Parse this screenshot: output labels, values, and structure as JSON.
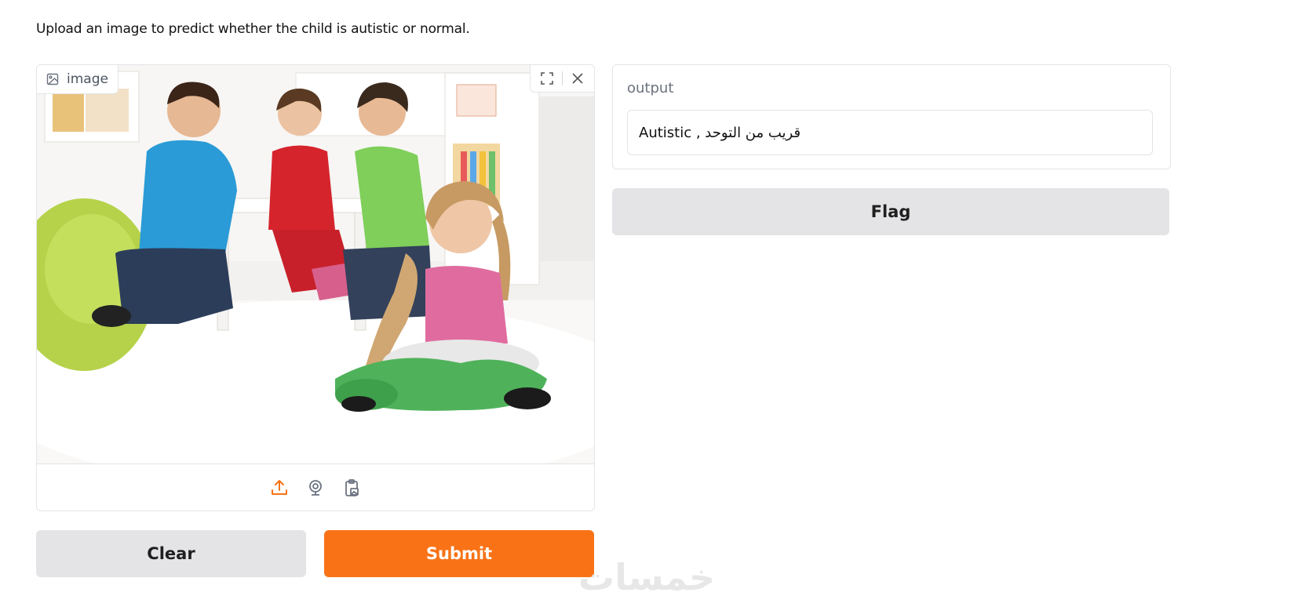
{
  "description": "Upload an image to predict whether the child is autistic or normal.",
  "image_input": {
    "label": "image",
    "label_icon": "image-icon",
    "tools": [
      "fullscreen-icon",
      "close-icon"
    ],
    "sources": [
      "upload-icon",
      "webcam-icon",
      "clipboard-icon"
    ]
  },
  "buttons": {
    "clear_label": "Clear",
    "submit_label": "Submit",
    "flag_label": "Flag"
  },
  "output": {
    "label": "output",
    "value": "Autistic , قريب من التوحد"
  },
  "watermark": "خمسات",
  "colors": {
    "accent": "#f97316",
    "secondary_button": "#e4e4e7",
    "border": "#e4e4e7"
  }
}
